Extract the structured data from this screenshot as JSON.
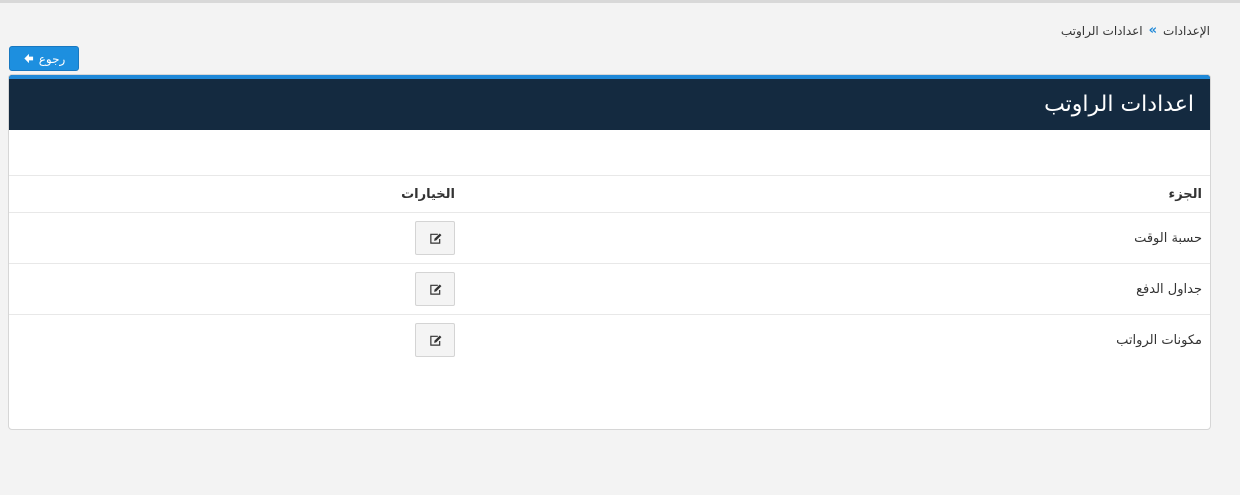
{
  "breadcrumb": {
    "parent": "الإعدادات",
    "separator": "»",
    "current": "اعدادات الراوتب"
  },
  "back_button": {
    "label": "رجوع",
    "icon": "arrow-left-icon",
    "color": "#1d8fdf"
  },
  "panel": {
    "title": "اعدادات الراوتب",
    "header_color": "#142a40",
    "accent_color": "#1e88d8"
  },
  "table": {
    "headers": {
      "part": "الجزء",
      "options": "الخيارات"
    },
    "rows": [
      {
        "part": "حسبة الوقت",
        "action_icon": "edit-icon"
      },
      {
        "part": "جداول الدفع",
        "action_icon": "edit-icon"
      },
      {
        "part": "مكونات الرواتب",
        "action_icon": "edit-icon"
      }
    ]
  }
}
